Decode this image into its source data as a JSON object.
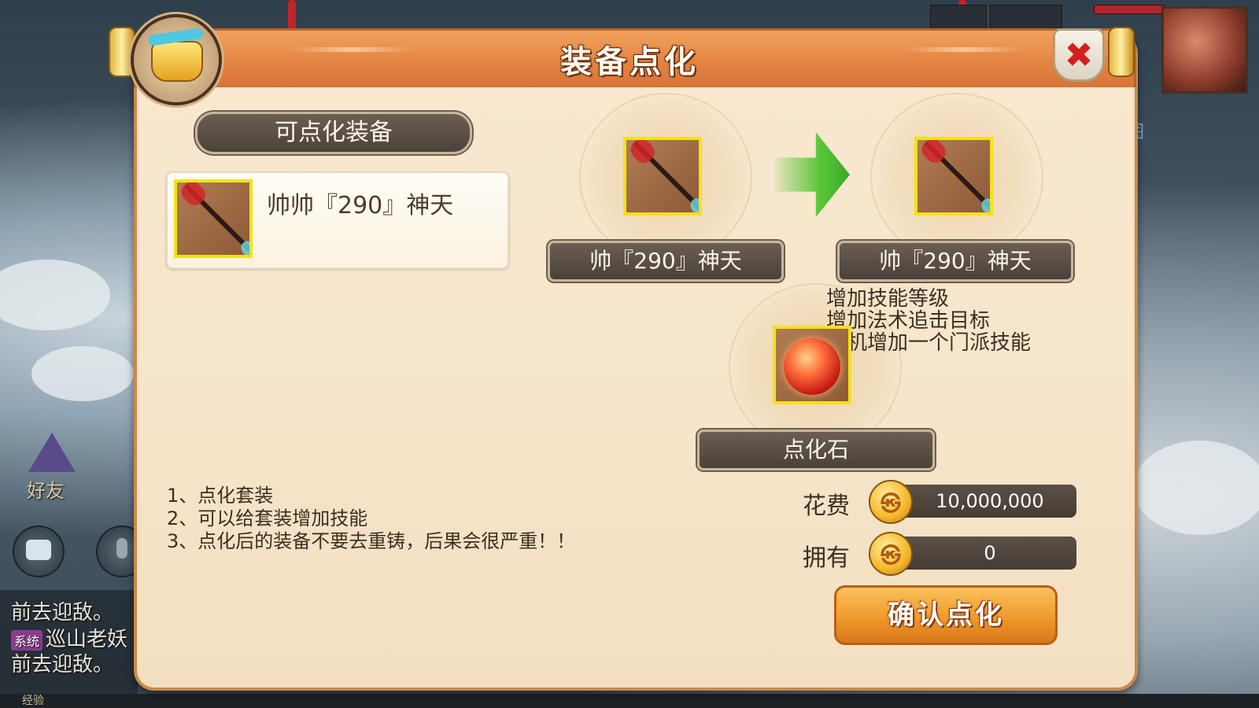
{
  "dialog": {
    "title": "装备点化",
    "close_symbol": "✖",
    "icon": "cauldron-icon"
  },
  "left_panel": {
    "header": "可点化装备",
    "item": {
      "name": "帅帅『290』神天",
      "icon": "spear-icon"
    },
    "rules": [
      "1、点化套装",
      "2、可以给套装增加技能",
      "3、点化后的装备不要去重铸，后果会很严重！！"
    ]
  },
  "preview": {
    "before_name": "帅『290』神天",
    "after_name": "帅『290』神天",
    "arrow_icon": "green-arrow-icon",
    "effects": [
      "增加技能等级",
      "增加法术追击目标",
      "随机增加一个门派技能"
    ],
    "stone_label": "点化石",
    "stone_icon": "red-orb-icon"
  },
  "cost": {
    "cost_label": "花费",
    "cost_value": "10,000,000",
    "own_label": "拥有",
    "own_value": "0",
    "coin_glyph": "㉿",
    "coin_icon": "gold-coin-icon"
  },
  "confirm_label": "确认点化",
  "background": {
    "friends_label": "好友",
    "chat_lines": [
      "前去迎敌。",
      "巡山老妖",
      "前去迎敌。"
    ],
    "chat_tag": "系统",
    "map_labels": [
      "地图",
      "图"
    ],
    "exp_label": "经验"
  },
  "colors": {
    "title_bar": "#e48542",
    "panel_bg": "#f8e8cf",
    "slot_border": "#f3e11d",
    "confirm_button": "#ef9a2c"
  }
}
